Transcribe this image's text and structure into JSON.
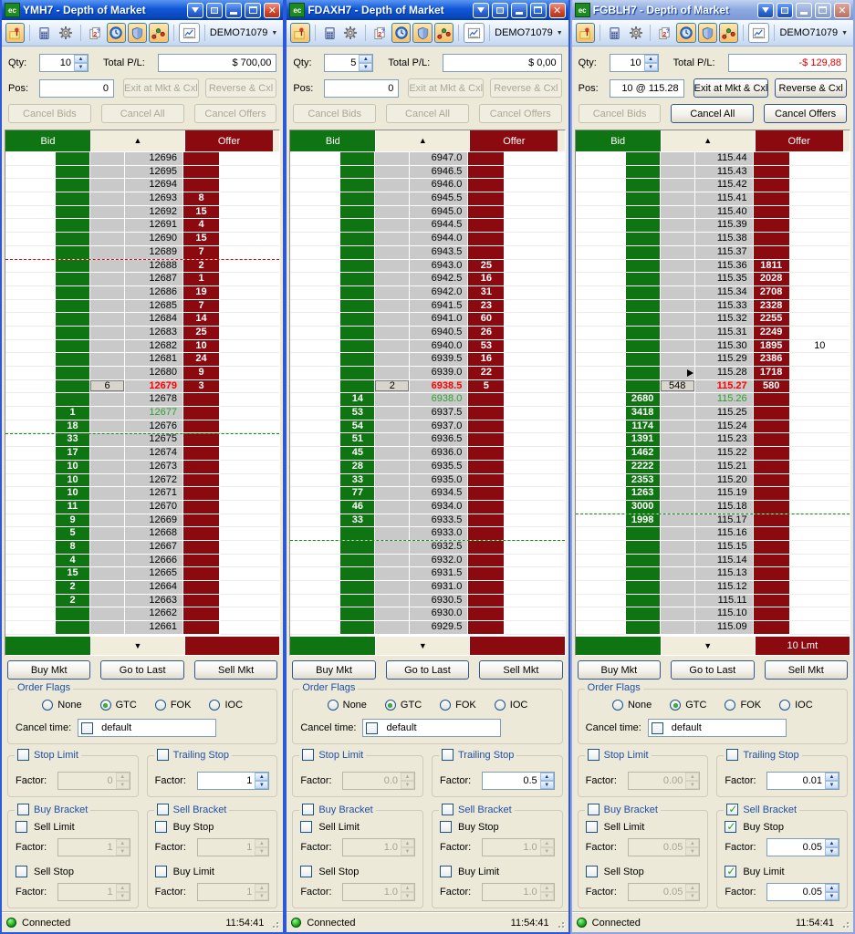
{
  "windows": [
    {
      "app_badge": "ec",
      "title": "YMH7 - Depth of Market",
      "inactive": false,
      "account": "DEMO71079",
      "qty_label": "Qty:",
      "qty": "10",
      "total_label": "Total P/L:",
      "total_pl": "$ 700,00",
      "total_negative": false,
      "pos_label": "Pos:",
      "pos": "0",
      "exit_label": "Exit at Mkt & Cxl",
      "exit_disabled": true,
      "reverse_label": "Reverse & Cxl",
      "reverse_disabled": true,
      "cancel_bids_label": "Cancel Bids",
      "cancel_bids_disabled": true,
      "cancel_all_label": "Cancel All",
      "cancel_all_disabled": true,
      "cancel_offers_label": "Cancel Offers",
      "cancel_offers_disabled": true,
      "bid_header": "Bid",
      "offer_header": "Offer",
      "ladder": {
        "rows": [
          [
            "12696",
            "",
            ""
          ],
          [
            "12695",
            "",
            ""
          ],
          [
            "12694",
            "",
            ""
          ],
          [
            "12693",
            "",
            "8"
          ],
          [
            "12692",
            "",
            "15"
          ],
          [
            "12691",
            "",
            "4"
          ],
          [
            "12690",
            "",
            "15"
          ],
          [
            "12689",
            "",
            "7"
          ],
          [
            "12688",
            "",
            "2"
          ],
          [
            "12687",
            "",
            "1"
          ],
          [
            "12686",
            "",
            "19"
          ],
          [
            "12685",
            "",
            "7"
          ],
          [
            "12684",
            "",
            "14"
          ],
          [
            "12683",
            "",
            "25"
          ],
          [
            "12682",
            "",
            "10"
          ],
          [
            "12681",
            "",
            "24"
          ],
          [
            "12680",
            "",
            "9"
          ],
          [
            "12679",
            "",
            "3"
          ],
          [
            "12678",
            "",
            ""
          ],
          [
            "12677",
            "1",
            ""
          ],
          [
            "12676",
            "18",
            ""
          ],
          [
            "12675",
            "33",
            ""
          ],
          [
            "12674",
            "17",
            ""
          ],
          [
            "12673",
            "10",
            ""
          ],
          [
            "12672",
            "10",
            ""
          ],
          [
            "12671",
            "10",
            ""
          ],
          [
            "12670",
            "11",
            ""
          ],
          [
            "12669",
            "9",
            ""
          ],
          [
            "12668",
            "5",
            ""
          ],
          [
            "12667",
            "8",
            ""
          ],
          [
            "12666",
            "4",
            ""
          ],
          [
            "12665",
            "15",
            ""
          ],
          [
            "12664",
            "2",
            ""
          ],
          [
            "12663",
            "2",
            ""
          ],
          [
            "12662",
            "",
            ""
          ],
          [
            "12661",
            "",
            ""
          ]
        ],
        "last_index": 17,
        "last_box": "6",
        "best_index": 19,
        "dash_red_after": 7,
        "dash_green_after": 20,
        "marker_index": null,
        "right_orders": [],
        "footer_right": ""
      },
      "buy_mkt": "Buy Mkt",
      "go_last": "Go to Last",
      "sell_mkt": "Sell Mkt",
      "flags_title": "Order Flags",
      "flag_none": "None",
      "flag_gtc": "GTC",
      "flag_fok": "FOK",
      "flag_ioc": "IOC",
      "flag_selected": "GTC",
      "cancel_time_label": "Cancel time:",
      "cancel_time_value": "default",
      "cancel_time_checked": false,
      "stop_limit_label": "Stop Limit",
      "stop_limit_checked": false,
      "factor_label": "Factor:",
      "stop_limit_factor": "0",
      "stop_limit_disabled": true,
      "trailing_label": "Trailing Stop",
      "trailing_checked": false,
      "trailing_factor": "1",
      "trailing_disabled": false,
      "buy_bracket_label": "Buy Bracket",
      "buy_bracket_checked": false,
      "bb_item1": "Sell Limit",
      "bb_item1_checked": false,
      "bb_factor1": "1",
      "bb_factor1_disabled": true,
      "bb_item2": "Sell Stop",
      "bb_item2_checked": false,
      "bb_factor2": "1",
      "bb_factor2_disabled": true,
      "sell_bracket_label": "Sell Bracket",
      "sell_bracket_checked": false,
      "sb_item1": "Buy Stop",
      "sb_item1_checked": false,
      "sb_factor1": "1",
      "sb_factor1_disabled": true,
      "sb_item2": "Buy Limit",
      "sb_item2_checked": false,
      "sb_factor2": "1",
      "sb_factor2_disabled": true,
      "connected": "Connected",
      "time": "11:54:41"
    },
    {
      "app_badge": "ec",
      "title": "FDAXH7 - Depth of Market",
      "inactive": false,
      "account": "DEMO71079",
      "qty_label": "Qty:",
      "qty": "5",
      "total_label": "Total P/L:",
      "total_pl": "$ 0,00",
      "total_negative": false,
      "pos_label": "Pos:",
      "pos": "0",
      "exit_label": "Exit at Mkt & Cxl",
      "exit_disabled": true,
      "reverse_label": "Reverse & Cxl",
      "reverse_disabled": true,
      "cancel_bids_label": "Cancel Bids",
      "cancel_bids_disabled": true,
      "cancel_all_label": "Cancel All",
      "cancel_all_disabled": true,
      "cancel_offers_label": "Cancel Offers",
      "cancel_offers_disabled": true,
      "bid_header": "Bid",
      "offer_header": "Offer",
      "ladder": {
        "rows": [
          [
            "6947.0",
            "",
            ""
          ],
          [
            "6946.5",
            "",
            ""
          ],
          [
            "6946.0",
            "",
            ""
          ],
          [
            "6945.5",
            "",
            ""
          ],
          [
            "6945.0",
            "",
            ""
          ],
          [
            "6944.5",
            "",
            ""
          ],
          [
            "6944.0",
            "",
            ""
          ],
          [
            "6943.5",
            "",
            ""
          ],
          [
            "6943.0",
            "",
            "25"
          ],
          [
            "6942.5",
            "",
            "16"
          ],
          [
            "6942.0",
            "",
            "31"
          ],
          [
            "6941.5",
            "",
            "23"
          ],
          [
            "6941.0",
            "",
            "60"
          ],
          [
            "6940.5",
            "",
            "26"
          ],
          [
            "6940.0",
            "",
            "53"
          ],
          [
            "6939.5",
            "",
            "16"
          ],
          [
            "6939.0",
            "",
            "22"
          ],
          [
            "6938.5",
            "",
            "5"
          ],
          [
            "6938.0",
            "14",
            ""
          ],
          [
            "6937.5",
            "53",
            ""
          ],
          [
            "6937.0",
            "54",
            ""
          ],
          [
            "6936.5",
            "51",
            ""
          ],
          [
            "6936.0",
            "45",
            ""
          ],
          [
            "6935.5",
            "28",
            ""
          ],
          [
            "6935.0",
            "33",
            ""
          ],
          [
            "6934.5",
            "77",
            ""
          ],
          [
            "6934.0",
            "46",
            ""
          ],
          [
            "6933.5",
            "33",
            ""
          ],
          [
            "6933.0",
            "",
            ""
          ],
          [
            "6932.5",
            "",
            ""
          ],
          [
            "6932.0",
            "",
            ""
          ],
          [
            "6931.5",
            "",
            ""
          ],
          [
            "6931.0",
            "",
            ""
          ],
          [
            "6930.5",
            "",
            ""
          ],
          [
            "6930.0",
            "",
            ""
          ],
          [
            "6929.5",
            "",
            ""
          ]
        ],
        "last_index": 17,
        "last_box": "2",
        "best_index": 18,
        "dash_red_after": null,
        "dash_green_after": 28,
        "marker_index": null,
        "right_orders": [],
        "footer_right": ""
      },
      "buy_mkt": "Buy Mkt",
      "go_last": "Go to Last",
      "sell_mkt": "Sell Mkt",
      "flags_title": "Order Flags",
      "flag_none": "None",
      "flag_gtc": "GTC",
      "flag_fok": "FOK",
      "flag_ioc": "IOC",
      "flag_selected": "GTC",
      "cancel_time_label": "Cancel time:",
      "cancel_time_value": "default",
      "cancel_time_checked": false,
      "stop_limit_label": "Stop Limit",
      "stop_limit_checked": false,
      "factor_label": "Factor:",
      "stop_limit_factor": "0.0",
      "stop_limit_disabled": true,
      "trailing_label": "Trailing Stop",
      "trailing_checked": false,
      "trailing_factor": "0.5",
      "trailing_disabled": false,
      "buy_bracket_label": "Buy Bracket",
      "buy_bracket_checked": false,
      "bb_item1": "Sell Limit",
      "bb_item1_checked": false,
      "bb_factor1": "1.0",
      "bb_factor1_disabled": true,
      "bb_item2": "Sell Stop",
      "bb_item2_checked": false,
      "bb_factor2": "1.0",
      "bb_factor2_disabled": true,
      "sell_bracket_label": "Sell Bracket",
      "sell_bracket_checked": false,
      "sb_item1": "Buy Stop",
      "sb_item1_checked": false,
      "sb_factor1": "1.0",
      "sb_factor1_disabled": true,
      "sb_item2": "Buy Limit",
      "sb_item2_checked": false,
      "sb_factor2": "1.0",
      "sb_factor2_disabled": true,
      "connected": "Connected",
      "time": "11:54:41"
    },
    {
      "app_badge": "ec",
      "title": "FGBLH7 - Depth of Market",
      "inactive": true,
      "account": "DEMO71079",
      "qty_label": "Qty:",
      "qty": "10",
      "total_label": "Total P/L:",
      "total_pl": "-$ 129,88",
      "total_negative": true,
      "pos_label": "Pos:",
      "pos": "10 @ 115.28",
      "exit_label": "Exit at Mkt & Cxl",
      "exit_disabled": false,
      "reverse_label": "Reverse & Cxl",
      "reverse_disabled": false,
      "cancel_bids_label": "Cancel Bids",
      "cancel_bids_disabled": true,
      "cancel_all_label": "Cancel All",
      "cancel_all_disabled": false,
      "cancel_offers_label": "Cancel Offers",
      "cancel_offers_disabled": false,
      "bid_header": "Bid",
      "offer_header": "Offer",
      "ladder": {
        "rows": [
          [
            "115.44",
            "",
            ""
          ],
          [
            "115.43",
            "",
            ""
          ],
          [
            "115.42",
            "",
            ""
          ],
          [
            "115.41",
            "",
            ""
          ],
          [
            "115.40",
            "",
            ""
          ],
          [
            "115.39",
            "",
            ""
          ],
          [
            "115.38",
            "",
            ""
          ],
          [
            "115.37",
            "",
            ""
          ],
          [
            "115.36",
            "",
            "1811"
          ],
          [
            "115.35",
            "",
            "2028"
          ],
          [
            "115.34",
            "",
            "2708"
          ],
          [
            "115.33",
            "",
            "2328"
          ],
          [
            "115.32",
            "",
            "2255"
          ],
          [
            "115.31",
            "",
            "2249"
          ],
          [
            "115.30",
            "",
            "1895"
          ],
          [
            "115.29",
            "",
            "2386"
          ],
          [
            "115.28",
            "",
            "1718"
          ],
          [
            "115.27",
            "",
            "580"
          ],
          [
            "115.26",
            "2680",
            ""
          ],
          [
            "115.25",
            "3418",
            ""
          ],
          [
            "115.24",
            "1174",
            ""
          ],
          [
            "115.23",
            "1391",
            ""
          ],
          [
            "115.22",
            "1462",
            ""
          ],
          [
            "115.21",
            "2222",
            ""
          ],
          [
            "115.20",
            "2353",
            ""
          ],
          [
            "115.19",
            "1263",
            ""
          ],
          [
            "115.18",
            "3000",
            ""
          ],
          [
            "115.17",
            "1998",
            ""
          ],
          [
            "115.16",
            "",
            ""
          ],
          [
            "115.15",
            "",
            ""
          ],
          [
            "115.14",
            "",
            ""
          ],
          [
            "115.13",
            "",
            ""
          ],
          [
            "115.12",
            "",
            ""
          ],
          [
            "115.11",
            "",
            ""
          ],
          [
            "115.10",
            "",
            ""
          ],
          [
            "115.09",
            "",
            ""
          ]
        ],
        "last_index": 17,
        "last_box": "548",
        "best_index": 18,
        "dash_red_after": null,
        "dash_green_after": 26,
        "marker_index": 16,
        "right_orders": [
          {
            "index": 14,
            "value": "10"
          }
        ],
        "footer_right": "10 Lmt"
      },
      "buy_mkt": "Buy Mkt",
      "go_last": "Go to Last",
      "sell_mkt": "Sell Mkt",
      "flags_title": "Order Flags",
      "flag_none": "None",
      "flag_gtc": "GTC",
      "flag_fok": "FOK",
      "flag_ioc": "IOC",
      "flag_selected": "GTC",
      "cancel_time_label": "Cancel time:",
      "cancel_time_value": "default",
      "cancel_time_checked": false,
      "stop_limit_label": "Stop Limit",
      "stop_limit_checked": false,
      "factor_label": "Factor:",
      "stop_limit_factor": "0.00",
      "stop_limit_disabled": true,
      "trailing_label": "Trailing Stop",
      "trailing_checked": false,
      "trailing_factor": "0.01",
      "trailing_disabled": false,
      "buy_bracket_label": "Buy Bracket",
      "buy_bracket_checked": false,
      "bb_item1": "Sell Limit",
      "bb_item1_checked": false,
      "bb_factor1": "0.05",
      "bb_factor1_disabled": true,
      "bb_item2": "Sell Stop",
      "bb_item2_checked": false,
      "bb_factor2": "0.05",
      "bb_factor2_disabled": true,
      "sell_bracket_label": "Sell Bracket",
      "sell_bracket_checked": true,
      "sb_item1": "Buy Stop",
      "sb_item1_checked": true,
      "sb_factor1": "0.05",
      "sb_factor1_disabled": false,
      "sb_item2": "Buy Limit",
      "sb_item2_checked": true,
      "sb_factor2": "0.05",
      "sb_factor2_disabled": false,
      "connected": "Connected",
      "time": "11:54:41"
    }
  ]
}
